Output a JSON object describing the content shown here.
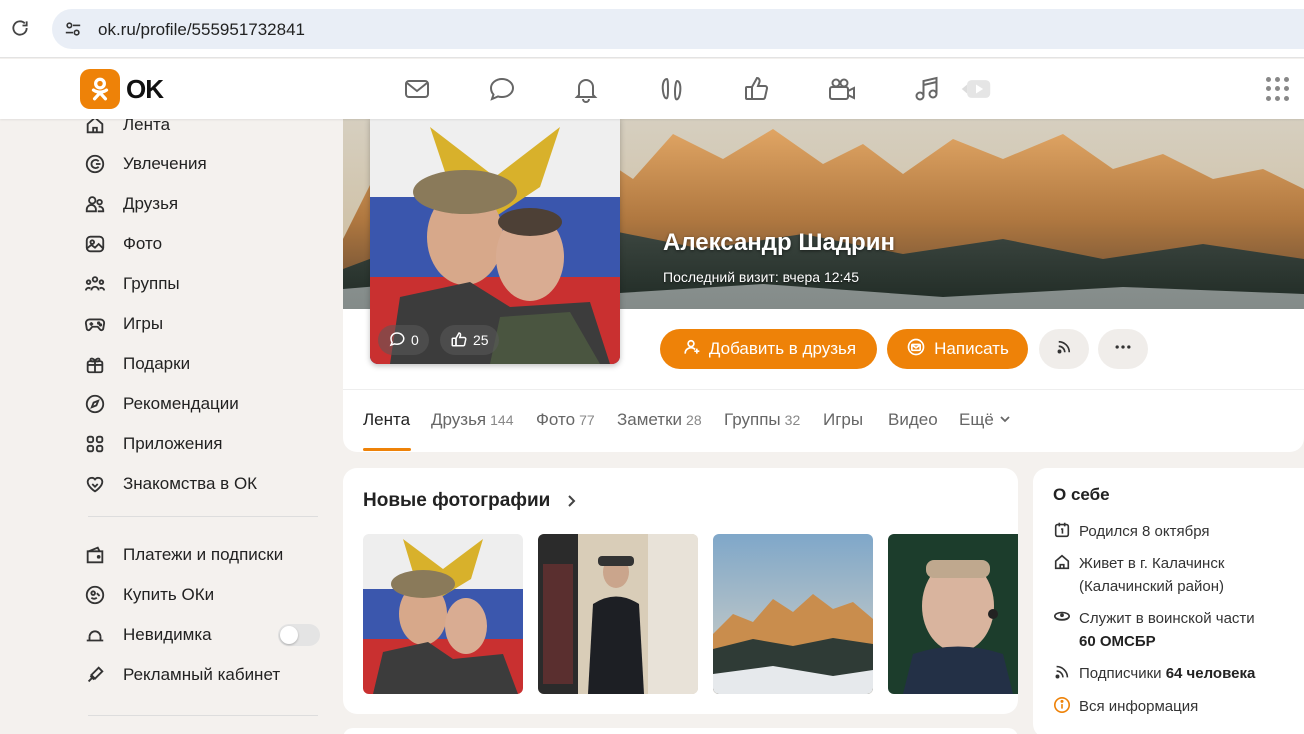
{
  "browser": {
    "url": "ok.ru/profile/555951732841"
  },
  "header": {
    "logo_text": "OK",
    "nav_icons": [
      "mail-icon",
      "chat-icon",
      "bell-icon",
      "friends-guests-icon",
      "like-icon",
      "video-camera-icon",
      "music-icon",
      "play-icon"
    ]
  },
  "sidebar": {
    "items": [
      {
        "label": "Лента",
        "icon": "home-icon"
      },
      {
        "label": "Увлечения",
        "icon": "hobby-icon"
      },
      {
        "label": "Друзья",
        "icon": "friends-icon"
      },
      {
        "label": "Фото",
        "icon": "photo-icon"
      },
      {
        "label": "Группы",
        "icon": "groups-icon"
      },
      {
        "label": "Игры",
        "icon": "gamepad-icon"
      },
      {
        "label": "Подарки",
        "icon": "gift-icon"
      },
      {
        "label": "Рекомендации",
        "icon": "compass-icon"
      },
      {
        "label": "Приложения",
        "icon": "apps-icon"
      },
      {
        "label": "Знакомства в ОК",
        "icon": "heart-icon"
      }
    ],
    "items2": [
      {
        "label": "Платежи и подписки",
        "icon": "wallet-icon"
      },
      {
        "label": "Купить ОКи",
        "icon": "coin-icon"
      },
      {
        "label": "Невидимка",
        "icon": "incognito-icon",
        "toggle": false
      },
      {
        "label": "Рекламный кабинет",
        "icon": "megaphone-icon"
      }
    ]
  },
  "profile": {
    "name": "Александр Шадрин",
    "last_visit": "Последний визит: вчера 12:45",
    "avatar_comments": "0",
    "avatar_likes": "25",
    "add_friend_label": "Добавить в друзья",
    "message_label": "Написать",
    "tabs": [
      {
        "label": "Лента",
        "count": ""
      },
      {
        "label": "Друзья",
        "count": "144"
      },
      {
        "label": "Фото",
        "count": "77"
      },
      {
        "label": "Заметки",
        "count": "28"
      },
      {
        "label": "Группы",
        "count": "32"
      },
      {
        "label": "Игры",
        "count": ""
      },
      {
        "label": "Видео",
        "count": ""
      },
      {
        "label": "Ещё",
        "count": ""
      }
    ]
  },
  "photos": {
    "title": "Новые фотографии"
  },
  "about": {
    "title": "О себе",
    "born": "Родился 8 октября",
    "lives_line1": "Живет в г. Калачинск",
    "lives_line2": "(Калачинский район)",
    "military_prefix": "Служит в воинской части",
    "military_unit": "60 ОМСБР",
    "subscribers_prefix": "Подписчики",
    "subscribers_count": "64 человека",
    "all_info": "Вся информация"
  },
  "colors": {
    "accent": "#ee8208",
    "background": "#f4f1ee"
  }
}
